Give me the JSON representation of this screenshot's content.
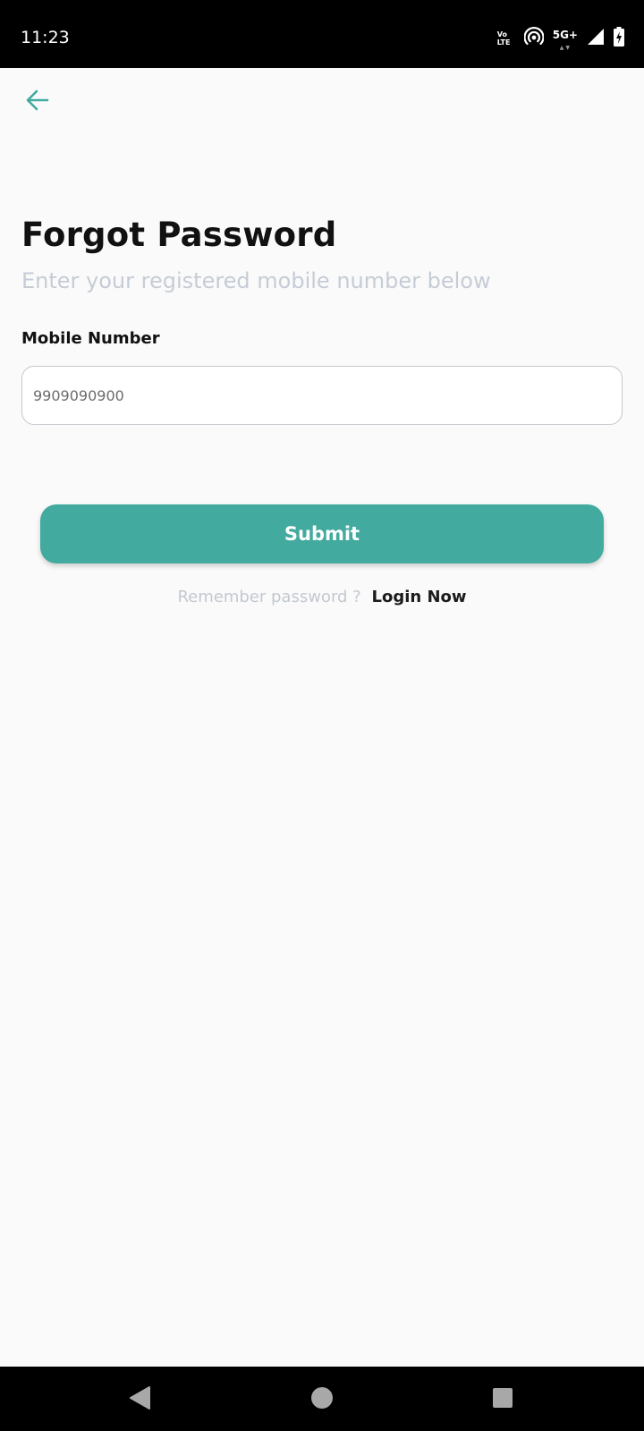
{
  "status_bar": {
    "time": "11:23",
    "volte_top": "Vo",
    "volte_bottom": "LTE",
    "network": "5G+",
    "icons": [
      "volte-icon",
      "hotspot-icon",
      "signal-icon",
      "battery-charging-icon"
    ]
  },
  "header": {
    "back_icon": "arrow-left-icon"
  },
  "main": {
    "title": "Forgot Password",
    "subtitle": "Enter your registered mobile number below",
    "mobile_label": "Mobile Number",
    "mobile_placeholder": "9909090900",
    "submit_label": "Submit",
    "remember_text": "Remember password ?",
    "login_link": "Login Now"
  },
  "nav_bar": {
    "icons": [
      "back-triangle-icon",
      "home-circle-icon",
      "recents-square-icon"
    ]
  },
  "colors": {
    "accent": "#42aa9f",
    "subtitle": "#c6ccd6",
    "background": "#fafafa"
  }
}
